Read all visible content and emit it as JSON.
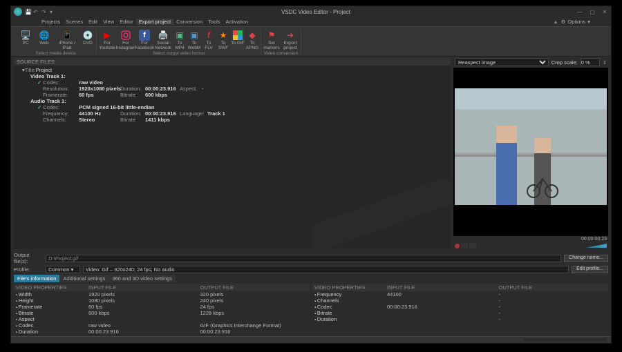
{
  "window": {
    "title": "VSDC Video Editor - Project"
  },
  "menubar": {
    "items": [
      "Projects",
      "Scenes",
      "Edit",
      "View",
      "Editor",
      "Export project",
      "Conversion",
      "Tools",
      "Activation"
    ],
    "active": 5,
    "options": "Options"
  },
  "ribbon": {
    "group_media": {
      "caption": "Select media device",
      "pc": "PC",
      "web": "Web",
      "iphone": "iPhone / iPad",
      "dvd": "DVD"
    },
    "group_format": {
      "caption": "Select output video format",
      "for_youtube": "For\nYoutube",
      "for_instagram": "For\nInstagram",
      "for_facebook": "For\nFacebook",
      "social": "Social\nNetwork",
      "to_mp4": "To\nMP4",
      "to_webm": "To\nWebM",
      "to_flv": "To\nFLV",
      "to_swf": "To\nSWF",
      "to_gif": "To\nGIF",
      "to_apng": "To\nAPNG"
    },
    "group_conv": {
      "caption": "Video conversion",
      "set_markers": "Set\nmarkers",
      "export_project": "Export\nproject"
    }
  },
  "source": {
    "header": "SOURCE FILES",
    "title_k": "Title:",
    "title_v": "Project",
    "vt_head": "Video Track 1:",
    "vt_codec_k": "Codec:",
    "vt_codec_v": "raw video",
    "vt_res_k": "Resolution:",
    "vt_res_v": "1920x1080 pixels",
    "vt_dur_k": "Duration:",
    "vt_dur_v": "00:00:23.916",
    "vt_asp_k": "Aspect:",
    "vt_asp_v": "-",
    "vt_fr_k": "Framerate:",
    "vt_fr_v": "60 fps",
    "vt_br_k": "Bitrate:",
    "vt_br_v": "600 kbps",
    "at_head": "Audio Track 1:",
    "at_codec_k": "Codec:",
    "at_codec_v": "PCM signed 16-bit little-endian",
    "at_freq_k": "Frequency:",
    "at_freq_v": "44100 Hz",
    "at_dur_k": "Duration:",
    "at_dur_v": "00:00:23.916",
    "at_lang_k": "Language:",
    "at_lang_v": "Track 1",
    "at_ch_k": "Channels:",
    "at_ch_v": "Stereo",
    "at_br_k": "Bitrate:",
    "at_br_v": "1411 kbps"
  },
  "preview": {
    "reaspect": "Reaspect image",
    "crop_label": "Crop scale:",
    "crop_value": "0 %",
    "timecode": "00:00:00:23"
  },
  "output": {
    "file_label": "Output file(s):",
    "file_value": "D:\\Project.gif",
    "profile_label": "Profile:",
    "profile_common": "Common",
    "profile_desc": "Video: Gif – 320x240; 24 fps; No audio",
    "change_name": "Change name...",
    "edit_profile": "Edit profile..."
  },
  "tabs": {
    "t1": "File's information",
    "t2": "Additional settings",
    "t3": "360 and 3D video settings"
  },
  "props": {
    "h_video": "VIDEO PROPERTIES",
    "h_in": "INPUT FILE",
    "h_out": "OUTPUT FILE",
    "left": [
      {
        "k": "Width",
        "in": "1920 pixels",
        "out": "320 pixels"
      },
      {
        "k": "Height",
        "in": "1080 pixels",
        "out": "240 pixels"
      },
      {
        "k": "Framerate",
        "in": "60 fps",
        "out": "24 fps"
      },
      {
        "k": "Bitrate",
        "in": "600 kbps",
        "out": "1228 kbps"
      },
      {
        "k": "Aspect",
        "in": "",
        "out": ""
      },
      {
        "k": "Codec",
        "in": "raw video",
        "out": "GIF (Graphics Interchange Format)"
      },
      {
        "k": "Duration",
        "in": "00:00:23.916",
        "out": "00:00:23.916"
      }
    ],
    "right": [
      {
        "k": "Frequency",
        "in": "44100",
        "out": "-"
      },
      {
        "k": "Channels",
        "in": "",
        "out": "-"
      },
      {
        "k": "Codec",
        "in": "00:00:23.916",
        "out": "-"
      },
      {
        "k": "Bitrate",
        "in": "",
        "out": "-"
      },
      {
        "k": "Duration",
        "in": "",
        "out": "-"
      }
    ]
  },
  "colors": {
    "accent": "#2a7a9a"
  }
}
